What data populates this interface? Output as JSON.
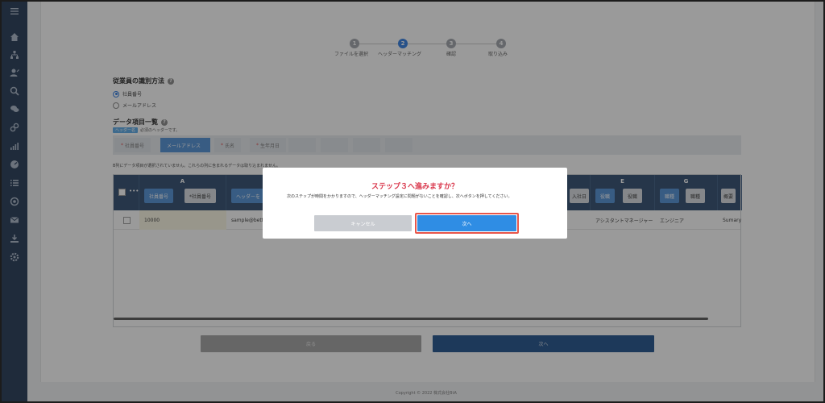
{
  "stepper": {
    "steps": [
      {
        "num": "1",
        "label": "ファイルを選択"
      },
      {
        "num": "2",
        "label": "ヘッダーマッチング"
      },
      {
        "num": "3",
        "label": "確認"
      },
      {
        "num": "4",
        "label": "取り込み"
      }
    ]
  },
  "identify": {
    "title": "従業員の識別方法",
    "help": "?",
    "options": [
      "社員番号",
      "メールアドレス"
    ]
  },
  "data_items": {
    "title": "データ項目一覧",
    "help": "?",
    "tag": "ヘッダー名",
    "tag_note": "必須のヘッダーです。",
    "chips": [
      "社員番号",
      "メールアドレス",
      "氏名",
      "生年月日",
      "",
      "",
      "",
      ""
    ]
  },
  "warning": "B列にデータ項目が選択されていません。これらの列に含まれるデータは取り込まれません。",
  "table": {
    "header_more": "•••",
    "columns": [
      {
        "letter": "A",
        "pill": "社員番号",
        "pill2": "*社員番号"
      },
      {
        "letter": "",
        "pill": "ヘッダーを",
        "pill2": ""
      },
      {
        "letter": "",
        "pill": "",
        "pill2": "入社日"
      },
      {
        "letter": "E",
        "pill": "役職",
        "pill2": "役職"
      },
      {
        "letter": "G",
        "pill": "職種",
        "pill2": "職種"
      },
      {
        "letter": "",
        "pill": "概要",
        "pill2": ""
      }
    ],
    "row": [
      "10000",
      "sample@bette",
      "アシスタントマネージャー",
      "エンジニア",
      "Sumary"
    ]
  },
  "buttons": {
    "back": "戻る",
    "next": "次へ"
  },
  "modal": {
    "title": "ステップ３へ進みますか？",
    "body": "次のステップが時間をかかりますので、ヘッダーマッチング設定に問題がないことを確認し、次へボタンを押してください。",
    "cancel": "キャンセル",
    "next": "次へ"
  },
  "footer": "Copyright © 2022 株式会社BtA",
  "colors": {
    "sidebar": "#1f3552",
    "accent": "#2f8de4",
    "modal_title": "#d9364b",
    "highlight": "#e8564a"
  }
}
